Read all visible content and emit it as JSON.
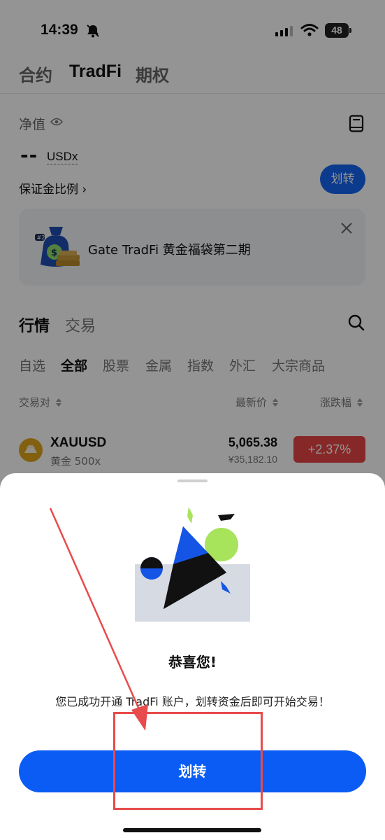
{
  "status_bar": {
    "time": "14:39",
    "battery": "48"
  },
  "top_tabs": [
    {
      "label": "合约",
      "active": false
    },
    {
      "label": "TradFi",
      "active": true
    },
    {
      "label": "期权",
      "active": false
    }
  ],
  "account": {
    "net_value_label": "净值",
    "value_placeholder": "--",
    "currency": "USDx",
    "margin_ratio_label": "保证金比例 ›",
    "transfer_label": "划转"
  },
  "promo": {
    "text": "Gate TradFi 黄金福袋第二期",
    "badge": "#2"
  },
  "section_tabs": [
    {
      "label": "行情",
      "active": true
    },
    {
      "label": "交易",
      "active": false
    }
  ],
  "sub_tabs": [
    {
      "label": "自选",
      "active": false
    },
    {
      "label": "全部",
      "active": true
    },
    {
      "label": "股票",
      "active": false
    },
    {
      "label": "金属",
      "active": false
    },
    {
      "label": "指数",
      "active": false
    },
    {
      "label": "外汇",
      "active": false
    },
    {
      "label": "大宗商品",
      "active": false
    }
  ],
  "columns": {
    "pair": "交易对",
    "price": "最新价",
    "change": "涨跌幅"
  },
  "market_rows": [
    {
      "symbol": "XAUUSD",
      "subname": "黄金 500x",
      "price": "5,065.38",
      "price_cny": "¥35,182.10",
      "change": "+2.37%"
    }
  ],
  "sheet": {
    "title": "恭喜您!",
    "description": "您已成功开通 TradFi 账户，划转资金后即可开始交易！",
    "button_label": "划转"
  },
  "colors": {
    "accent": "#0a5cf5",
    "down_up": "#e84545",
    "annotation": "#e84b4b"
  }
}
